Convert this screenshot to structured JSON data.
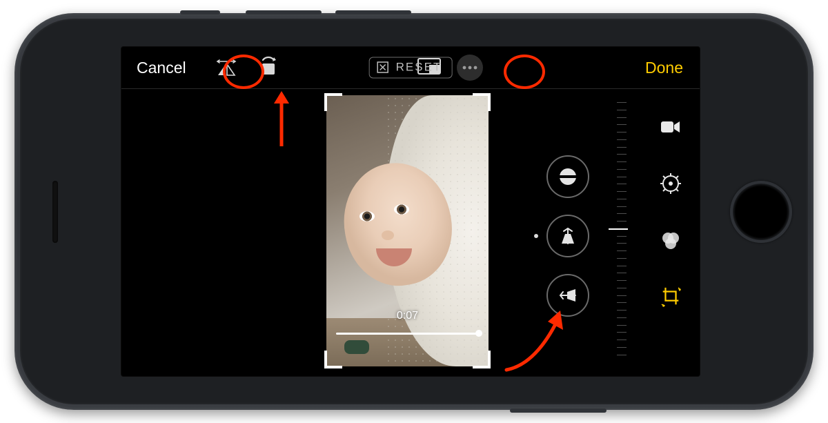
{
  "topbar": {
    "cancel": "Cancel",
    "done": "Done",
    "reset": "RESET"
  },
  "video": {
    "time": "0:07"
  },
  "icons": {
    "flip": "flip-horizontal-icon",
    "rotate": "rotate-icon",
    "reset_x": "reset-x-icon",
    "aspect": "aspect-ratio-icon",
    "more": "more-icon",
    "straighten": "straighten-icon",
    "perspective_v": "perspective-vertical-icon",
    "perspective_h": "perspective-horizontal-icon",
    "mode_video": "video-mode-icon",
    "mode_adjust": "adjust-mode-icon",
    "mode_filters": "filters-mode-icon",
    "mode_crop": "crop-mode-icon"
  },
  "colors": {
    "accent": "#ffcc00",
    "annotation": "#ff2a00"
  },
  "annotations": {
    "circle_flip": "highlighting flip button",
    "circle_aspect": "highlighting aspect ratio button",
    "arrow_rotate": "pointing to rotate button",
    "arrow_curve": "pointing to adjustment dials"
  }
}
